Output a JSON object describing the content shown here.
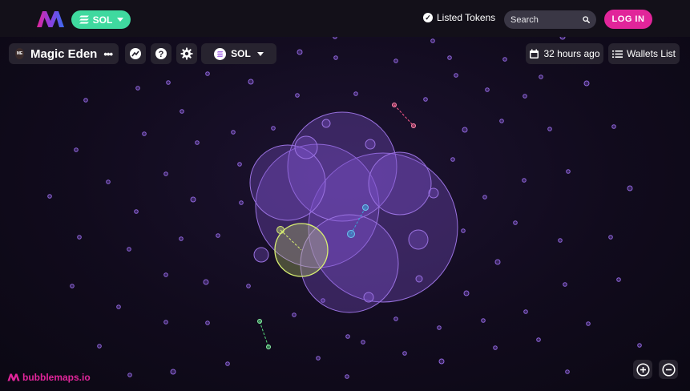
{
  "header": {
    "chain_selector": {
      "label": "SOL",
      "icon": "solana-icon"
    },
    "listed_tokens_label": "Listed Tokens",
    "search": {
      "placeholder": "Search",
      "icon": "search-icon"
    },
    "login_label": "LOG IN"
  },
  "toolbar": {
    "token_name": "Magic Eden",
    "token_avatar_text": "ME",
    "more_icon": "more-dots-icon",
    "buttons": [
      {
        "icon": "chart-icon"
      },
      {
        "icon": "help-icon"
      },
      {
        "icon": "gear-icon"
      }
    ],
    "network_select": {
      "label": "SOL",
      "icon": "solana-icon"
    },
    "time_label": "32 hours ago",
    "time_icon": "calendar-icon",
    "wallets_list_label": "Wallets List",
    "wallets_list_icon": "list-icon"
  },
  "footer": {
    "brand_label": "bubblemaps.io",
    "zoom_in_icon": "zoom-in-icon",
    "zoom_out_icon": "zoom-out-icon"
  },
  "colors": {
    "accent_green": "#3fd99f",
    "accent_pink": "#e1259a",
    "bubble_purple": "#7a4fc9",
    "bubble_highlight": "#d8ef72",
    "link_blue": "#3aa3d6",
    "link_red": "#ff5a8c",
    "link_green": "#59e07f"
  }
}
